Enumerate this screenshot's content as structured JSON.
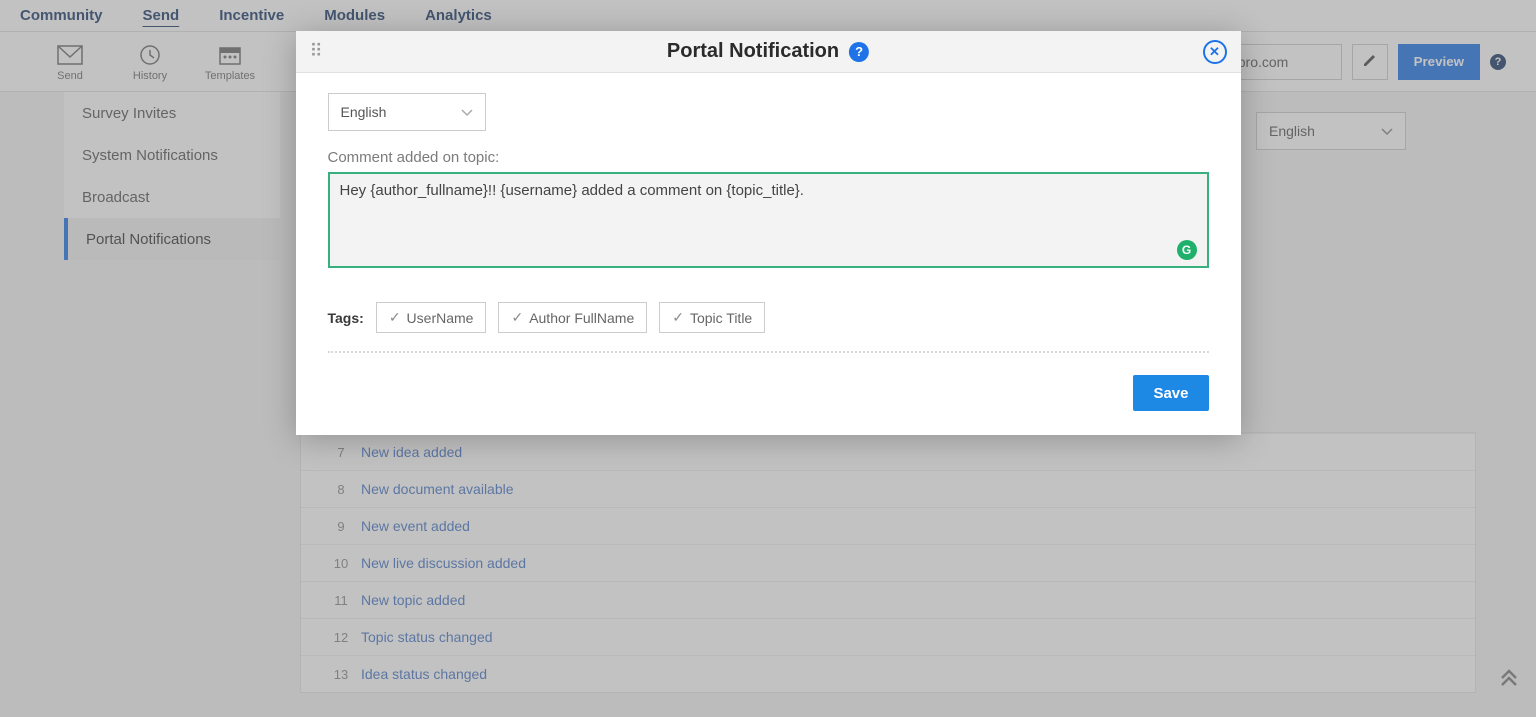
{
  "topnav": {
    "items": [
      "Community",
      "Send",
      "Incentive",
      "Modules",
      "Analytics"
    ],
    "active": 1
  },
  "toolbar": {
    "send": "Send",
    "history": "History",
    "templates": "Templates",
    "url_fragment": "uestionpro.com",
    "preview": "Preview"
  },
  "sidebar": {
    "items": [
      "Survey Invites",
      "System Notifications",
      "Broadcast",
      "Portal Notifications"
    ],
    "active": 3
  },
  "page_lang": "English",
  "list": {
    "rows": [
      {
        "n": "7",
        "t": "New idea added"
      },
      {
        "n": "8",
        "t": "New document available"
      },
      {
        "n": "9",
        "t": "New event added"
      },
      {
        "n": "10",
        "t": "New live discussion added"
      },
      {
        "n": "11",
        "t": "New topic added"
      },
      {
        "n": "12",
        "t": "Topic status changed"
      },
      {
        "n": "13",
        "t": "Idea status changed"
      }
    ]
  },
  "modal": {
    "title": "Portal Notification",
    "lang": "English",
    "field_label": "Comment added on topic:",
    "textarea_value": "Hey  {author_fullname}!!  {username} added a comment on {topic_title}.",
    "tags_label": "Tags:",
    "tags": [
      "UserName",
      "Author FullName",
      "Topic Title"
    ],
    "save": "Save"
  }
}
